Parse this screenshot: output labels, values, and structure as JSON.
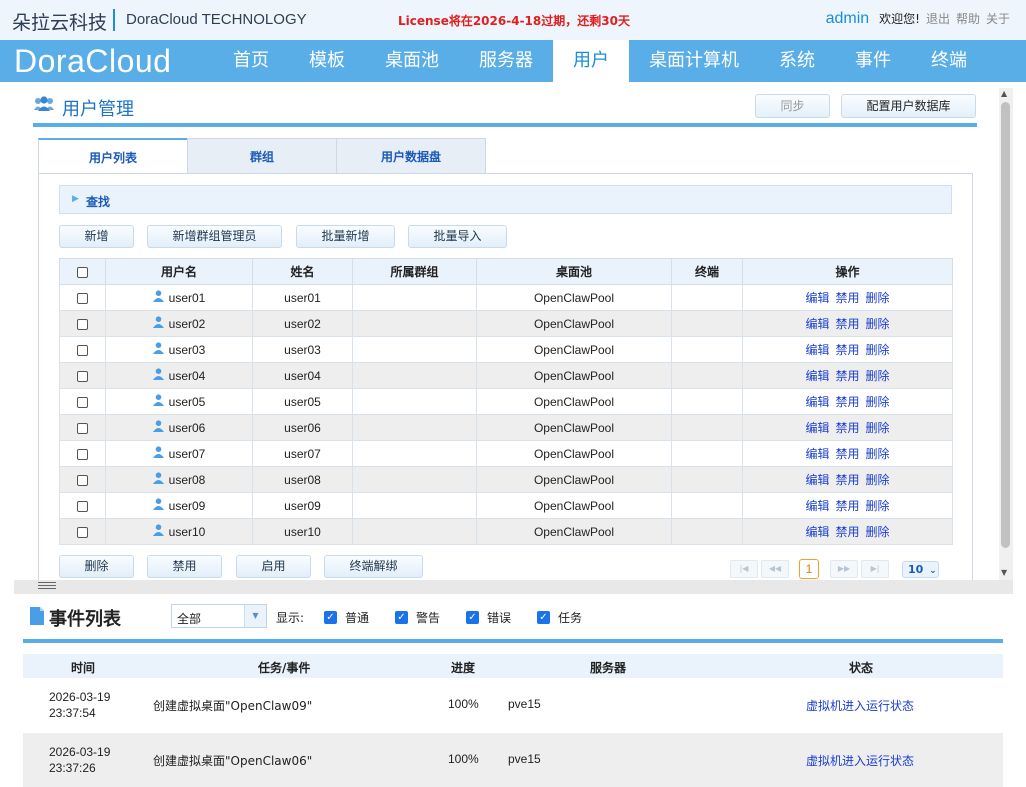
{
  "header": {
    "brand_cn": "朵拉云科技",
    "brand_en": "DoraCloud TECHNOLOGY",
    "license_notice": "License将在2026-4-18过期，还剩30天",
    "username": "admin",
    "welcome": "欢迎您!",
    "links": [
      "退出",
      "帮助",
      "关于"
    ]
  },
  "nav": {
    "logo": "DoraCloud",
    "items": [
      "首页",
      "模板",
      "桌面池",
      "服务器",
      "用户",
      "桌面计算机",
      "系统",
      "事件",
      "终端"
    ],
    "active": "用户"
  },
  "page": {
    "title": "用户管理",
    "sync_button": "同步",
    "config_db_button": "配置用户数据库"
  },
  "tabs": [
    "用户列表",
    "群组",
    "用户数据盘"
  ],
  "search": {
    "label": "查找"
  },
  "actions_top": [
    "新增",
    "新增群组管理员",
    "批量新增",
    "批量导入"
  ],
  "user_table": {
    "columns": [
      "用户名",
      "姓名",
      "所属群组",
      "桌面池",
      "终端",
      "操作"
    ],
    "rows": [
      {
        "username": "user01",
        "name": "user01",
        "group": "",
        "pool": "OpenClawPool",
        "terminal": ""
      },
      {
        "username": "user02",
        "name": "user02",
        "group": "",
        "pool": "OpenClawPool",
        "terminal": ""
      },
      {
        "username": "user03",
        "name": "user03",
        "group": "",
        "pool": "OpenClawPool",
        "terminal": ""
      },
      {
        "username": "user04",
        "name": "user04",
        "group": "",
        "pool": "OpenClawPool",
        "terminal": ""
      },
      {
        "username": "user05",
        "name": "user05",
        "group": "",
        "pool": "OpenClawPool",
        "terminal": ""
      },
      {
        "username": "user06",
        "name": "user06",
        "group": "",
        "pool": "OpenClawPool",
        "terminal": ""
      },
      {
        "username": "user07",
        "name": "user07",
        "group": "",
        "pool": "OpenClawPool",
        "terminal": ""
      },
      {
        "username": "user08",
        "name": "user08",
        "group": "",
        "pool": "OpenClawPool",
        "terminal": ""
      },
      {
        "username": "user09",
        "name": "user09",
        "group": "",
        "pool": "OpenClawPool",
        "terminal": ""
      },
      {
        "username": "user10",
        "name": "user10",
        "group": "",
        "pool": "OpenClawPool",
        "terminal": ""
      }
    ],
    "row_ops": [
      "编辑",
      "禁用",
      "删除"
    ]
  },
  "actions_bottom": [
    "删除",
    "禁用",
    "启用",
    "终端解绑"
  ],
  "pager": {
    "current_page": "1",
    "page_size": "10"
  },
  "events": {
    "title": "事件列表",
    "filter_value": "全部",
    "show_label": "显示:",
    "filters": [
      "普通",
      "警告",
      "错误",
      "任务"
    ],
    "columns": [
      "时间",
      "任务/事件",
      "进度",
      "服务器",
      "状态"
    ],
    "rows": [
      {
        "date": "2026-03-19",
        "time": "23:37:54",
        "task": "创建虚拟桌面\"OpenClaw09\"",
        "progress": "100%",
        "server": "pve15",
        "status": "虚拟机进入运行状态"
      },
      {
        "date": "2026-03-19",
        "time": "23:37:26",
        "task": "创建虚拟桌面\"OpenClaw06\"",
        "progress": "100%",
        "server": "pve15",
        "status": "虚拟机进入运行状态"
      }
    ]
  },
  "colors": {
    "primary": "#5aaee8",
    "link": "#1a3fd0",
    "warning": "#e02020",
    "title_blue": "#1a73c8"
  }
}
